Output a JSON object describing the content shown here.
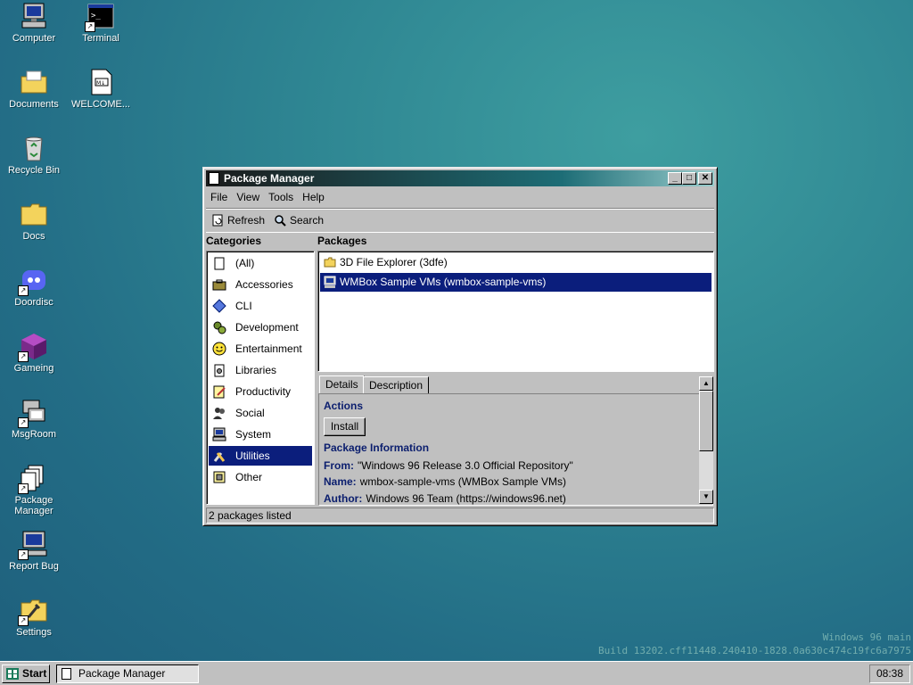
{
  "desktop": {
    "icons": [
      {
        "label": "Computer",
        "icon": "computer-icon"
      },
      {
        "label": "Terminal",
        "icon": "terminal-icon"
      },
      {
        "label": "Documents",
        "icon": "documents-folder-icon"
      },
      {
        "label": "WELCOME...",
        "icon": "markdown-file-icon"
      },
      {
        "label": "Recycle Bin",
        "icon": "recycle-bin-icon"
      },
      {
        "label": "Docs",
        "icon": "folder-icon"
      },
      {
        "label": "Doordisc",
        "icon": "discord-icon"
      },
      {
        "label": "Gameing",
        "icon": "game-cube-icon"
      },
      {
        "label": "MsgRoom",
        "icon": "msgroom-icon"
      },
      {
        "label": "Package Manager",
        "icon": "package-manager-icon"
      },
      {
        "label": "Report Bug",
        "icon": "report-bug-icon"
      },
      {
        "label": "Settings",
        "icon": "settings-icon"
      }
    ],
    "watermark_line1": "Windows 96 main",
    "watermark_line2": "Build 13202.cff11448.240410-1828.0a630c474c19fc6a7975"
  },
  "window": {
    "title": "Package Manager",
    "menu": [
      "File",
      "View",
      "Tools",
      "Help"
    ],
    "toolbar": {
      "refresh": "Refresh",
      "search": "Search"
    },
    "categories_label": "Categories",
    "packages_label": "Packages",
    "categories": [
      "(All)",
      "Accessories",
      "CLI",
      "Development",
      "Entertainment",
      "Libraries",
      "Productivity",
      "Social",
      "System",
      "Utilities",
      "Other"
    ],
    "selected_category": "Utilities",
    "packages": [
      "3D File Explorer (3dfe)",
      "WMBox Sample VMs (wmbox-sample-vms)"
    ],
    "selected_package": "WMBox Sample VMs (wmbox-sample-vms)",
    "tabs": [
      "Details",
      "Description"
    ],
    "details": {
      "actions_title": "Actions",
      "install_label": "Install",
      "info_title": "Package Information",
      "from_key": "From:",
      "from_val": "\"Windows 96 Release 3.0 Official Repository\"",
      "name_key": "Name:",
      "name_val": "wmbox-sample-vms (WMBox Sample VMs)",
      "author_key": "Author:",
      "author_val": "Windows 96 Team (https://windows96.net)"
    },
    "status": "2 packages listed"
  },
  "taskbar": {
    "start_label": "Start",
    "task_label": "Package Manager",
    "clock": "08:38"
  },
  "colors": {
    "selection": "#0b1e7c",
    "face": "#c0c0c0",
    "label_blue": "#0b1e6e"
  }
}
